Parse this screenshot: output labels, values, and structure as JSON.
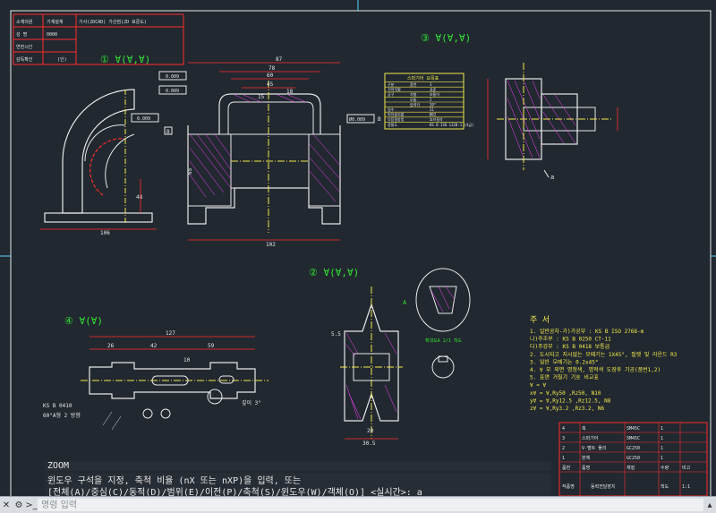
{
  "title_block": {
    "rows": [
      {
        "label": "소재의원",
        "value": "기계설계"
      },
      {
        "label": "성 명",
        "value": "0000"
      },
      {
        "label": "연번시간",
        "value": ""
      },
      {
        "label": "감독확인",
        "value": "(인)"
      }
    ],
    "header_text": "기사(2DCAD) 가산점(2D 표준도)"
  },
  "views": {
    "v1": "① ∀(∀,∀)",
    "v2": "② ∀(∀,∀)",
    "v3": "③ ∀(∀,∀)",
    "v4": "④ ∀(∀)"
  },
  "dims": {
    "d87": "87",
    "d78": "78",
    "d60": "60",
    "d45": "45",
    "d18": "18",
    "d15": "15",
    "d65": "65",
    "d102": "102",
    "d106": "106",
    "d48": "48",
    "d127": "127",
    "d26": "26",
    "d42": "42",
    "d59": "59",
    "d305": "30.5",
    "d20": "20",
    "d10": "10",
    "d55": "5.5",
    "tol1": "0.009",
    "tol2": "0.009",
    "tol3": "0.009",
    "tol4": "Ø0.009"
  },
  "gear_table": {
    "title": "스퍼기어 요목표",
    "rows": [
      [
        "구분",
        "품번",
        "3"
      ],
      [
        "기어치형",
        "",
        "표준"
      ],
      [
        "공구",
        "치형",
        "보통이"
      ],
      [
        "",
        "모듈",
        "2"
      ],
      [
        "",
        "압력각",
        "20°"
      ],
      [
        "잇수",
        "",
        "31"
      ],
      [
        "피치원지름",
        "",
        "Ø62"
      ],
      [
        "다듬질방법",
        "",
        "호브절삭"
      ],
      [
        "정밀도",
        "",
        "KS B ISO 1328-1 (4급)"
      ]
    ]
  },
  "notes": {
    "title": "주 서",
    "lines": [
      "1. 일반공차-가)가공부 : KS B ISO 2768-m",
      "              나)주조부 : KS B 0250 CT-11",
      "              다)주강부 : KS B 0418 보통급",
      "2. 도시되고 지시없는 모떼기는 1X45°, 필렛 및 라운드 R3",
      "3. 일반 모떼기는 0.2x45°",
      "4. ∀ 부 외면 명청색, 명적색 도장후 기공(품번1,2)",
      "5. 표면 거칠기 기호 비교표",
      "  ∀ = ∀",
      "  x∀ = ∀,Ry50 ,Rz50, N10",
      "  y∀ = ∀,Ry12.5 ,Rz12.5, N8",
      "  z∀ = ∀,Ry3.2 ,Rz3.2, N6"
    ]
  },
  "parts_list": {
    "rows": [
      [
        "4",
        "축",
        "SM45C",
        "1",
        ""
      ],
      [
        "3",
        "스퍼기어",
        "SM45C",
        "1",
        ""
      ],
      [
        "2",
        "V-벨트 풀리",
        "GC250",
        "1",
        ""
      ],
      [
        "1",
        "본체",
        "GC250",
        "1",
        ""
      ],
      [
        "품번",
        "품명",
        "재질",
        "수량",
        "비고"
      ]
    ],
    "footer": [
      "작품명",
      "동력전달장치",
      "척도",
      "1:1"
    ]
  },
  "labels": {
    "ks": "KS B 0410",
    "ks2": "60°A형 2 방향",
    "detail": "확대도A 2/1 척도",
    "keyway": "깊이 3°",
    "A": "A",
    "B": "B",
    "a": "a"
  },
  "command": {
    "history": [
      "ZOOM",
      "윈도우 구석을 지정, 축척 비율 (nX 또는 nXP)을 입력, 또는",
      "[전체(A)/중심(C)/동적(D)/범위(E)/이전(P)/축척(S)/윈도우(W)/객체(O)] <실시간>: a"
    ],
    "placeholder": "명령 입력"
  },
  "colors": {
    "background": "#212830",
    "outline": "#e8e8e8",
    "red": "#ff2d2d",
    "yellow": "#f2e84a",
    "green": "#32e632",
    "magenta": "#ff40ff",
    "cyan": "#5bd8ff"
  }
}
